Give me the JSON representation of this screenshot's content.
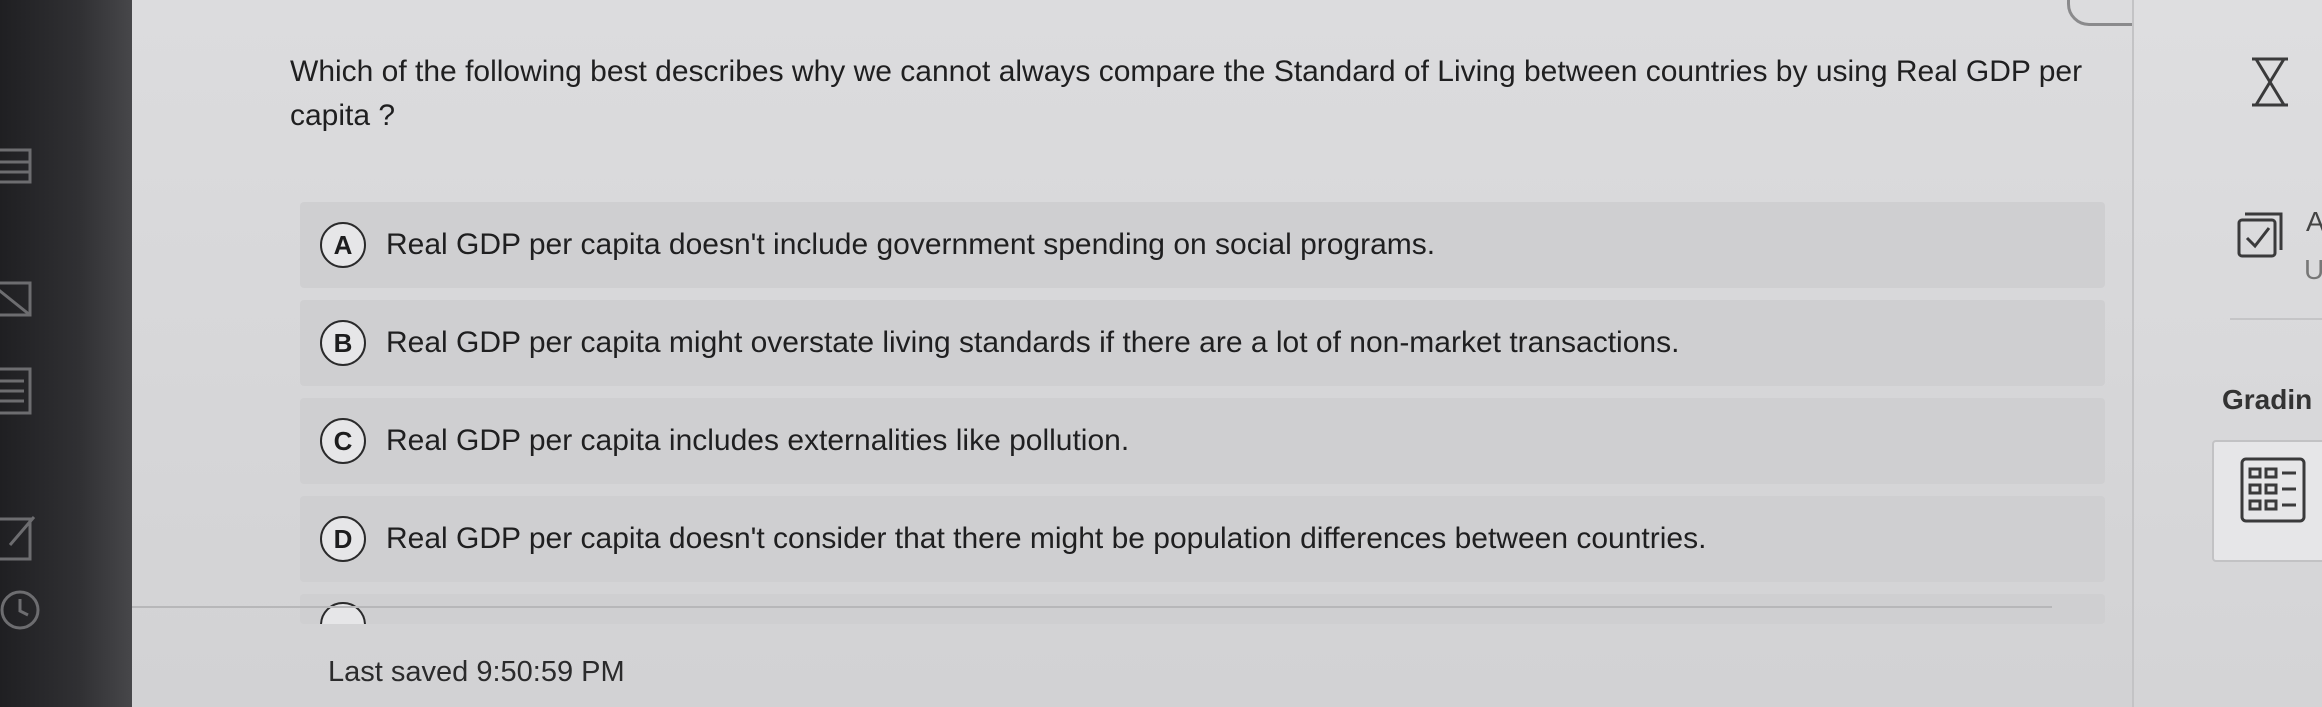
{
  "question": {
    "text": "Which of the following best describes why we cannot always compare the Standard of Living between countries by using Real GDP per capita ?"
  },
  "options": [
    {
      "letter": "A",
      "text": "Real GDP per capita doesn't include government spending on social programs."
    },
    {
      "letter": "B",
      "text": "Real GDP per capita might overstate living standards if there are a lot of non-market transactions."
    },
    {
      "letter": "C",
      "text": "Real GDP per capita includes externalities like pollution."
    },
    {
      "letter": "D",
      "text": "Real GDP per capita doesn't consider that there might be population differences between countries."
    }
  ],
  "status": {
    "last_saved": "Last saved 9:50:59 PM"
  },
  "sidebar": {
    "timer_icon": "hourglass-icon",
    "check_icon": "checkbox-icon",
    "letter_a": "A",
    "letter_u": "U",
    "grading_label": "Gradin",
    "grading_icon": "grid-calculator-icon"
  },
  "colors": {
    "panel_bg": "#d6d6d8",
    "option_bg": "#cfcfd1",
    "text": "#1f1f20",
    "rail_bg": "#2a2a2d"
  }
}
